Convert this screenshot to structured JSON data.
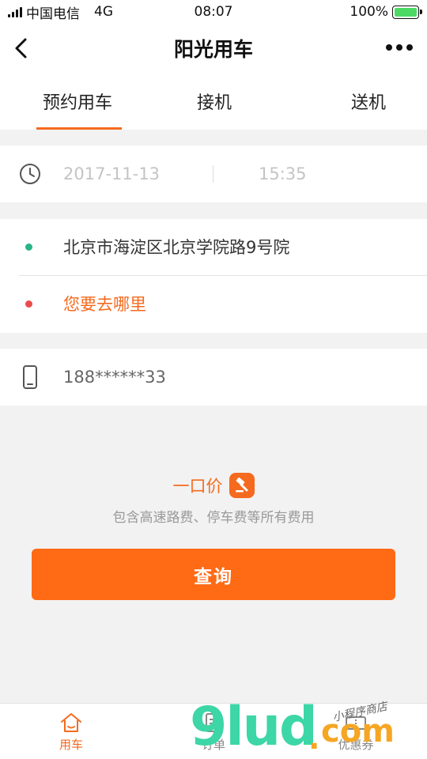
{
  "status_bar": {
    "carrier": "中国电信",
    "network": "4G",
    "time": "08:07",
    "battery": "100%"
  },
  "nav": {
    "title": "阳光用车"
  },
  "tabs": [
    {
      "label": "预约用车",
      "active": true
    },
    {
      "label": "接机",
      "active": false
    },
    {
      "label": "送机",
      "active": false
    }
  ],
  "booking": {
    "date": "2017-11-13",
    "time": "15:35",
    "start_address": "北京市海淀区北京学院路9号院",
    "destination_placeholder": "您要去哪里",
    "phone": "188******33"
  },
  "price": {
    "title": "一口价",
    "subtitle": "包含高速路费、停车费等所有费用"
  },
  "query_button": "查询",
  "tabbar": [
    {
      "label": "用车",
      "icon": "home-icon",
      "active": true
    },
    {
      "label": "订单",
      "icon": "order-icon",
      "active": false
    },
    {
      "label": "优惠券",
      "icon": "coupon-icon",
      "active": false
    }
  ],
  "watermark": {
    "main": "9lud",
    "dot": ".",
    "suffix": "com",
    "script": "小程序商店"
  },
  "colors": {
    "accent": "#f56a1e",
    "button": "#ff6a14",
    "start_dot": "#27b488",
    "dest_dot": "#e84c4c",
    "battery": "#4cd964"
  }
}
